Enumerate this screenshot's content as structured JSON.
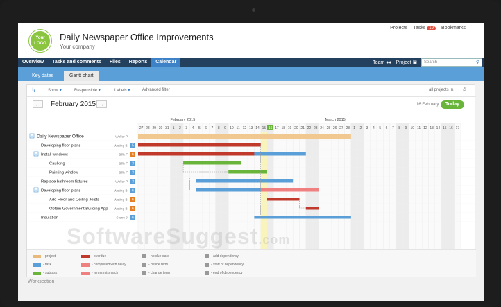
{
  "app": {
    "logo_lines": [
      "Your",
      "LOGO"
    ],
    "project_title": "Daily Newspaper Office Improvements",
    "company": "Your company",
    "top_links": {
      "projects": "Projects",
      "tasks": "Tasks",
      "tasks_badge": "19",
      "bookmarks": "Bookmarks"
    }
  },
  "nav": {
    "items": [
      "Overview",
      "Tasks and comments",
      "Files",
      "Reports",
      "Calendar"
    ],
    "active": "Calendar",
    "team": "Team",
    "project": "Project",
    "search_placeholder": "Search"
  },
  "subnav": {
    "tabs": [
      "Key dates",
      "Gantt chart"
    ],
    "active": "Gantt chart"
  },
  "filters": {
    "show": "Show",
    "responsible": "Responsible",
    "labels": "Labels",
    "advanced": "Advanced filter",
    "all_projects": "all projects"
  },
  "calendar": {
    "month_title": "February 2015",
    "date_label": "16 February",
    "today_label": "Today",
    "month_labels": [
      "February 2015",
      "March 2015"
    ],
    "days": [
      "27",
      "28",
      "29",
      "30",
      "31",
      "1",
      "2",
      "3",
      "4",
      "5",
      "6",
      "7",
      "8",
      "9",
      "10",
      "11",
      "12",
      "13",
      "14",
      "15",
      "16",
      "17",
      "18",
      "19",
      "20",
      "21",
      "22",
      "23",
      "24",
      "25",
      "26",
      "27",
      "28",
      "1",
      "2",
      "3",
      "4",
      "5",
      "6",
      "7",
      "8",
      "9",
      "10",
      "11",
      "12",
      "13",
      "14",
      "15",
      "16",
      "17"
    ],
    "today_index": 20
  },
  "tasks": [
    {
      "name": "Daily Newspaper Office",
      "person": "Weller P.",
      "num": "",
      "kind": "project",
      "indent": 0,
      "start": 0,
      "end": 33
    },
    {
      "name": "Developing floor plans",
      "person": "Woting B.",
      "num": "5",
      "kind": "task",
      "indent": 1,
      "start": 0,
      "end": 19
    },
    {
      "name": "Install windows",
      "person": "Bills F.",
      "num": "6",
      "kind": "task",
      "indent": 1,
      "start": 0,
      "end": 26
    },
    {
      "name": "Caulking",
      "person": "Bills F.",
      "num": "3",
      "kind": "subtask",
      "indent": 2,
      "start": 7,
      "end": 16
    },
    {
      "name": "Painting window",
      "person": "Bills F.",
      "num": "3",
      "kind": "subtask",
      "indent": 2,
      "start": 14,
      "end": 20
    },
    {
      "name": "Replace bathroom fixtures",
      "person": "Weller P.",
      "num": "3",
      "kind": "task",
      "indent": 1,
      "start": 9,
      "end": 24
    },
    {
      "name": "Developing floor plans",
      "person": "Woting B.",
      "num": "6",
      "kind": "task",
      "indent": 1,
      "start": 9,
      "end": 28
    },
    {
      "name": "Add Floor and Ceiling Joists",
      "person": "Woting B.",
      "num": "6",
      "kind": "overdue",
      "indent": 2,
      "start": 20,
      "end": 25
    },
    {
      "name": "Obtain Government Building App",
      "person": "Woting B.",
      "num": "6",
      "kind": "overdue",
      "indent": 2,
      "start": 26,
      "end": 28
    },
    {
      "name": "Insulation",
      "person": "Stone J.",
      "num": "6",
      "kind": "task",
      "indent": 1,
      "start": 18,
      "end": 33
    }
  ],
  "legend": [
    {
      "label": "- project",
      "color": "#e8b97a"
    },
    {
      "label": "- task",
      "color": "#5b9fd8"
    },
    {
      "label": "- subtask",
      "color": "#69b53b"
    },
    {
      "label": "- overdue",
      "color": "#c0392b"
    },
    {
      "label": "- completed with delay",
      "color": "#f08080"
    },
    {
      "label": "- terms mismatch",
      "color": "#f08080"
    },
    {
      "label": "- no due-date",
      "color": "#999999"
    },
    {
      "label": "- define term",
      "color": "#999999"
    },
    {
      "label": "- change term",
      "color": "#999999"
    },
    {
      "label": "- add dependency",
      "color": "#999999"
    },
    {
      "label": "- start of dependency",
      "color": "#999999"
    },
    {
      "label": "- end of dependency",
      "color": "#999999"
    }
  ],
  "footer": "Worksection",
  "watermark": {
    "main": "SoftwareSuggest",
    "suffix": ".com"
  },
  "colors": {
    "project": "#f0c890",
    "task": "#5b9fd8",
    "subtask": "#69b53b",
    "overdue": "#c0392b",
    "nav": "#23405f",
    "active": "#3d82c6",
    "today": "#69b53b"
  }
}
